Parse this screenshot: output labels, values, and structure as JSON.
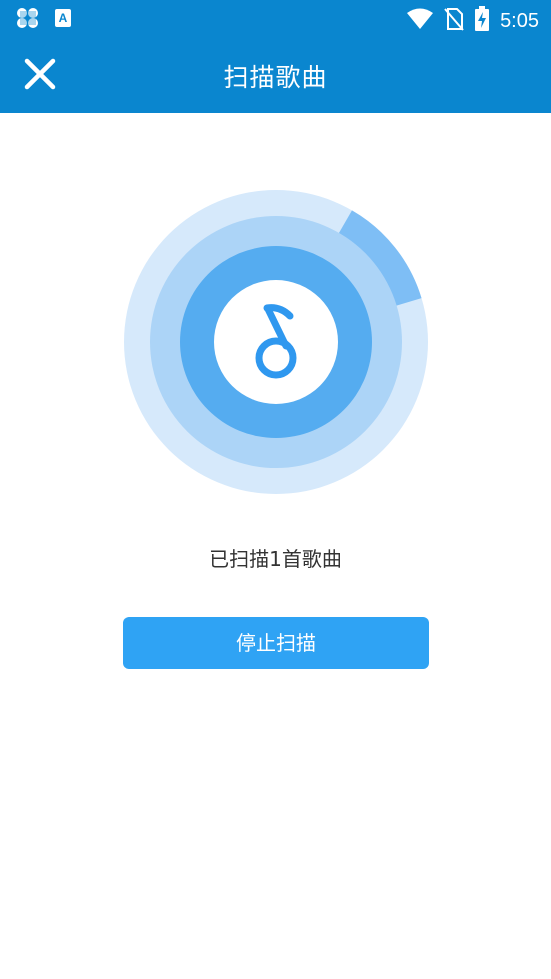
{
  "status_bar": {
    "time": "5:05",
    "icons": [
      "app-notification-icon",
      "text-a-icon",
      "wifi-icon",
      "no-sim-icon",
      "battery-charging-icon"
    ]
  },
  "app_bar": {
    "title": "扫描歌曲",
    "close_icon": "close-icon"
  },
  "scan": {
    "icon": "music-note-icon",
    "progress": 0.12
  },
  "status": {
    "text": "已扫描1首歌曲"
  },
  "actions": {
    "stop_label": "停止扫描"
  },
  "colors": {
    "brand": "#0a86cf",
    "button": "#2fa3f4",
    "ring_outer": "#d6e9fb",
    "ring_mid": "#acd4f7",
    "ring_inner": "#55acf0",
    "icon": "#2f98ef"
  }
}
